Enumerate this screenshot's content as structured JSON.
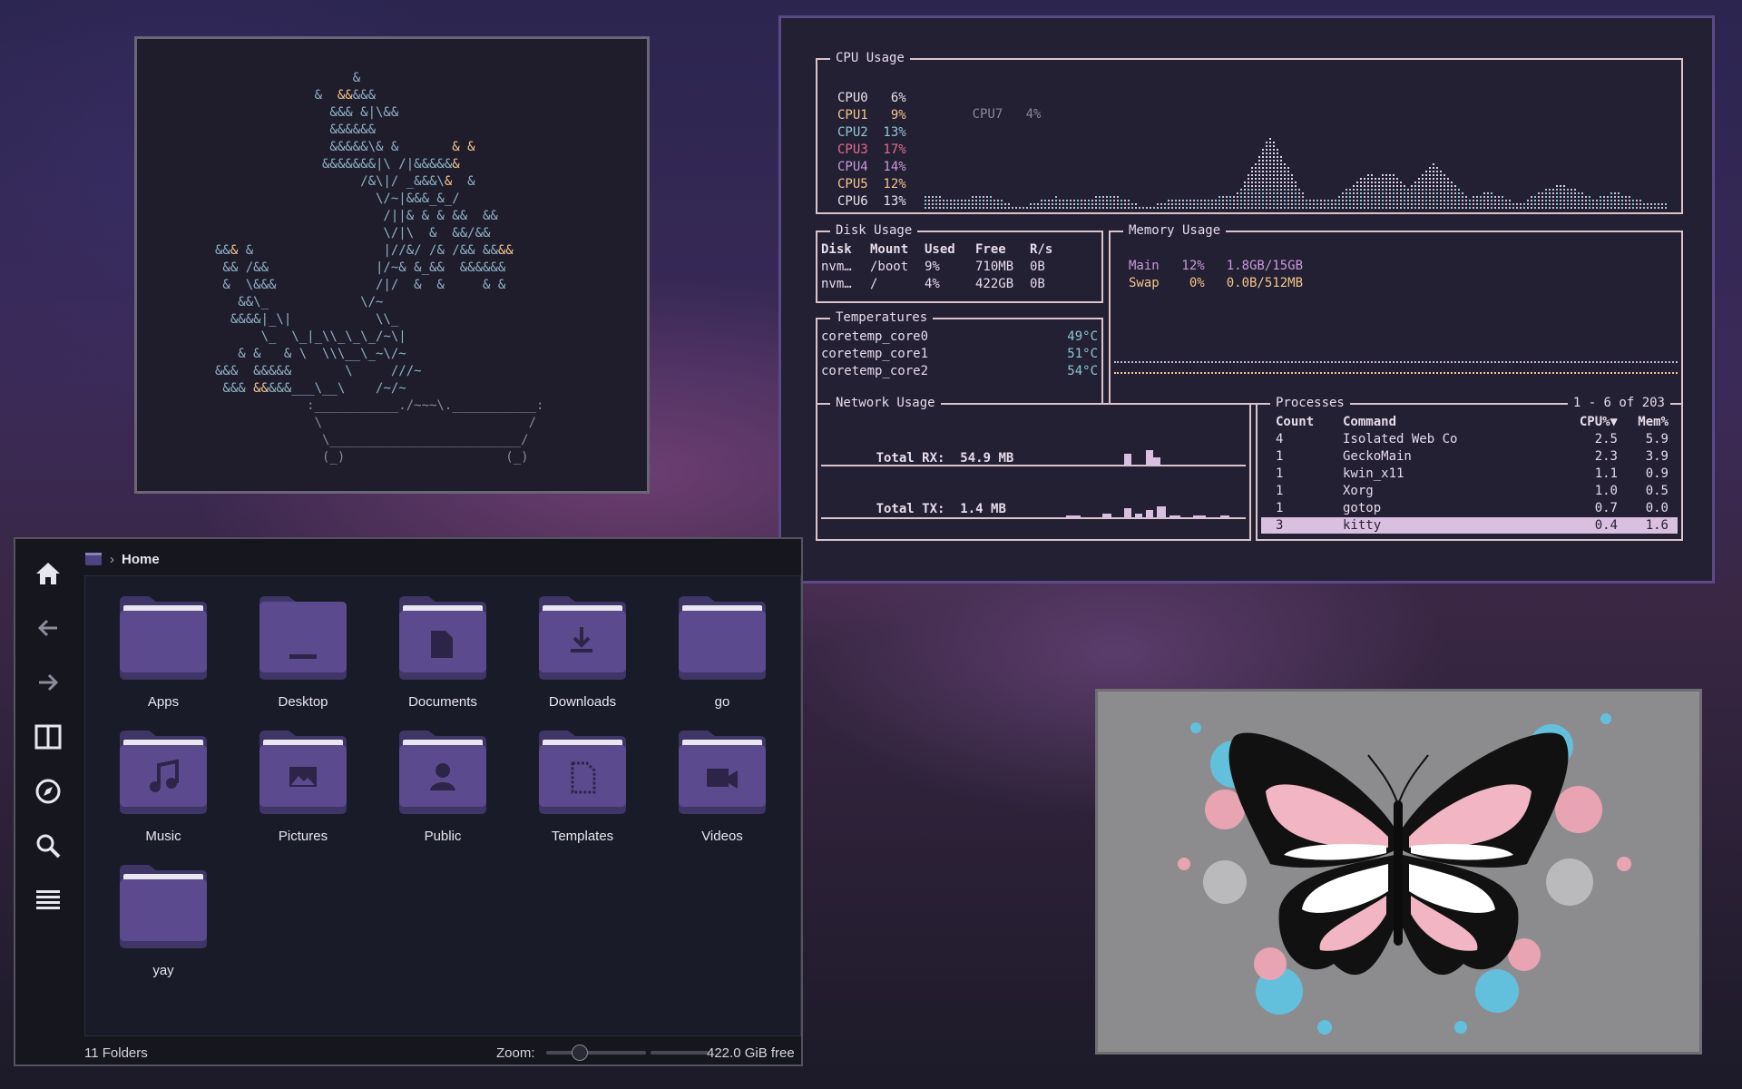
{
  "gotop": {
    "cpu": {
      "title": "CPU Usage",
      "cores": [
        {
          "name": "CPU0",
          "pct": "6%",
          "color": "#e8e0ea"
        },
        {
          "name": "CPU1",
          "pct": "9%",
          "color": "#f3c58c"
        },
        {
          "name": "CPU2",
          "pct": "13%",
          "color": "#8ec7d2"
        },
        {
          "name": "CPU3",
          "pct": "17%",
          "color": "#e06c8f"
        },
        {
          "name": "CPU4",
          "pct": "14%",
          "color": "#c79ad8"
        },
        {
          "name": "CPU5",
          "pct": "12%",
          "color": "#f3c58c"
        },
        {
          "name": "CPU6",
          "pct": "13%",
          "color": "#e8e0ea"
        }
      ],
      "cpu7": {
        "name": "CPU7",
        "pct": "4%",
        "color": "#8a8694"
      }
    },
    "disk": {
      "title": "Disk Usage",
      "headers": [
        "Disk",
        "Mount",
        "Used",
        "Free",
        "R/s"
      ],
      "rows": [
        [
          "nvm…",
          "/boot",
          "9%",
          "710MB",
          "0B"
        ],
        [
          "nvm…",
          "/",
          "4%",
          "422GB",
          "0B"
        ]
      ]
    },
    "memory": {
      "title": "Memory Usage",
      "rows": [
        {
          "name": "Main",
          "pct": "12%",
          "value": "1.8GB/15GB",
          "color": "#c79ad8"
        },
        {
          "name": "Swap",
          "pct": "0%",
          "value": "0.0B/512MB",
          "color": "#f3c58c"
        }
      ]
    },
    "temps": {
      "title": "Temperatures",
      "rows": [
        {
          "name": "coretemp_core0",
          "value": "49°C"
        },
        {
          "name": "coretemp_core1",
          "value": "51°C"
        },
        {
          "name": "coretemp_core2",
          "value": "54°C"
        }
      ]
    },
    "network": {
      "title": "Network Usage",
      "rx_label": "Total RX:",
      "rx_value": "54.9 MB",
      "tx_label": "Total TX:",
      "tx_value": "1.4 MB"
    },
    "processes": {
      "title": "Processes",
      "range": "1 - 6 of 203",
      "headers": [
        "Count",
        "Command",
        "CPU%▼",
        "Mem%"
      ],
      "rows": [
        [
          "4",
          "Isolated Web Co",
          "2.5",
          "5.9"
        ],
        [
          "1",
          "GeckoMain",
          "2.3",
          "3.9"
        ],
        [
          "1",
          "kwin_x11",
          "1.1",
          "0.9"
        ],
        [
          "1",
          "Xorg",
          "1.0",
          "0.5"
        ],
        [
          "1",
          "gotop",
          "0.7",
          "0.0"
        ],
        [
          "3",
          "kitty",
          "0.4",
          "1.6"
        ]
      ],
      "selected_index": 5
    }
  },
  "files": {
    "breadcrumb": "Home",
    "folders": [
      {
        "label": "Apps",
        "icon": "folder-icon"
      },
      {
        "label": "Desktop",
        "icon": "desktop-folder-icon"
      },
      {
        "label": "Documents",
        "icon": "documents-folder-icon"
      },
      {
        "label": "Downloads",
        "icon": "downloads-folder-icon"
      },
      {
        "label": "go",
        "icon": "folder-icon"
      },
      {
        "label": "Music",
        "icon": "music-folder-icon"
      },
      {
        "label": "Pictures",
        "icon": "pictures-folder-icon"
      },
      {
        "label": "Public",
        "icon": "public-folder-icon"
      },
      {
        "label": "Templates",
        "icon": "templates-folder-icon"
      },
      {
        "label": "Videos",
        "icon": "videos-folder-icon"
      },
      {
        "label": "yay",
        "icon": "folder-icon"
      }
    ],
    "status": {
      "count": "11 Folders",
      "zoom_label": "Zoom:",
      "free_space": "422.0 GiB free"
    }
  },
  "colors": {
    "accent": "#5b4a8e",
    "selection": "#d9bfe0"
  }
}
